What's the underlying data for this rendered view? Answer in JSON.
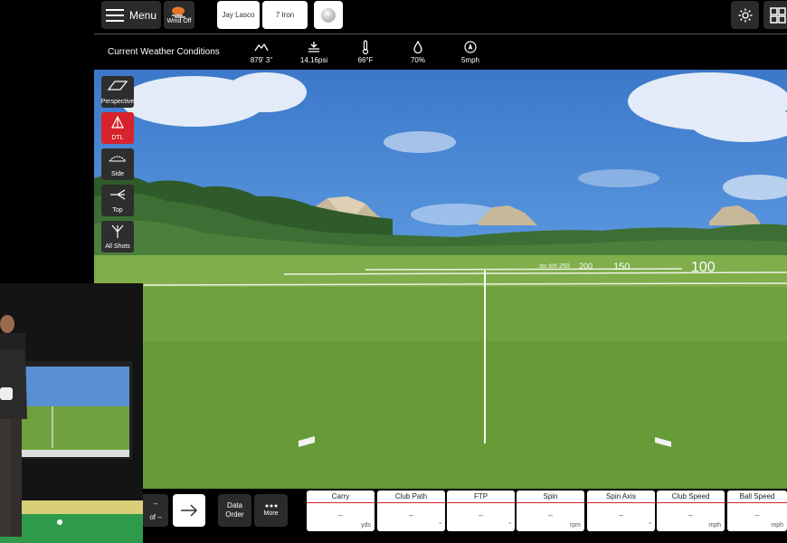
{
  "topbar": {
    "menu_label": "Menu",
    "wind_label": "Wind Off",
    "player_name": "Jay Lasco",
    "club": "7 Iron"
  },
  "weather": {
    "title": "Current Weather Conditions",
    "items": [
      {
        "icon": "altitude-icon",
        "value": "879' 3''"
      },
      {
        "icon": "pressure-icon",
        "value": "14.16psi"
      },
      {
        "icon": "thermometer-icon",
        "value": "66°F"
      },
      {
        "icon": "humidity-drop-icon",
        "value": "70%"
      },
      {
        "icon": "wind-compass-icon",
        "value": "5mph"
      }
    ]
  },
  "views": [
    {
      "label": "Perspective",
      "active": false
    },
    {
      "label": "DTL",
      "active": true
    },
    {
      "label": "Side",
      "active": false
    },
    {
      "label": "Top",
      "active": false
    },
    {
      "label": "All Shots",
      "active": false
    }
  ],
  "distance_markers": [
    "100",
    "150",
    "200",
    "250",
    "300",
    "350"
  ],
  "bottombar": {
    "shot_top": "–",
    "shot_bottom": "of –",
    "data_order_label": "Data Order",
    "more_label": "More"
  },
  "stats": [
    {
      "label": "Carry",
      "value": "–",
      "unit": "yds"
    },
    {
      "label": "Club Path",
      "value": "–",
      "unit": "°"
    },
    {
      "label": "FTP",
      "value": "–",
      "unit": "°"
    },
    {
      "label": "Spin",
      "value": "–",
      "unit": "rpm"
    },
    {
      "label": "Spin Axis",
      "value": "–",
      "unit": "°"
    },
    {
      "label": "Club Speed",
      "value": "–",
      "unit": "mph"
    },
    {
      "label": "Ball Speed",
      "value": "–",
      "unit": "mph"
    }
  ],
  "colors": {
    "accent": "#d7232b",
    "bar": "#2b2b2b"
  }
}
